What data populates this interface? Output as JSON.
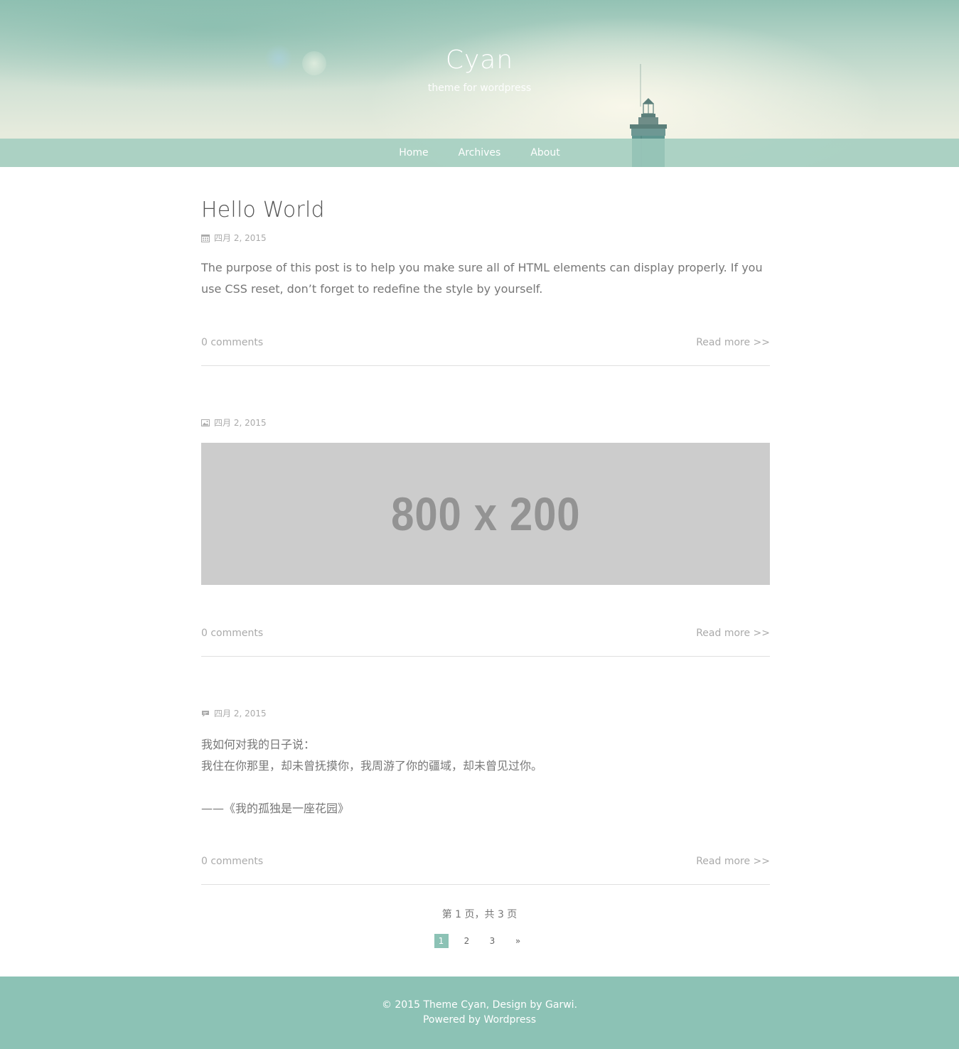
{
  "site": {
    "title": "Cyan",
    "description": "theme for wordpress"
  },
  "nav": {
    "items": [
      {
        "label": "Home"
      },
      {
        "label": "Archives"
      },
      {
        "label": "About"
      }
    ]
  },
  "posts": [
    {
      "title": "Hello World",
      "date": "四月 2, 2015",
      "meta_icon": "calendar-icon",
      "excerpt": "The purpose of this post is to help you make sure all of HTML elements can display properly. If you use CSS reset, don’t forget to redefine the style by yourself.",
      "comments": "0 comments",
      "read_more": "Read more >>"
    },
    {
      "date": "四月 2, 2015",
      "meta_icon": "image-icon",
      "image_placeholder": "800 x 200",
      "comments": "0 comments",
      "read_more": "Read more >>"
    },
    {
      "date": "四月 2, 2015",
      "meta_icon": "chat-bubble-icon",
      "quote_lines": [
        "我如何对我的日子说：",
        "我住在你那里，却未曾抚摸你，我周游了你的疆域，却未曾见过你。",
        "",
        "——《我的孤独是一座花园》"
      ],
      "comments": "0 comments",
      "read_more": "Read more >>"
    }
  ],
  "pagination": {
    "info": "第 1 页，共 3 页",
    "pages": [
      "1",
      "2",
      "3"
    ],
    "current": "1",
    "next": "»"
  },
  "footer": {
    "line1": "© 2015 Theme Cyan, Design by Garwi.",
    "line2": "Powered by Wordpress"
  },
  "colors": {
    "accent": "#8cc2b5",
    "nav_bg": "#a0cdbe",
    "placeholder_bg": "#cccccc"
  }
}
